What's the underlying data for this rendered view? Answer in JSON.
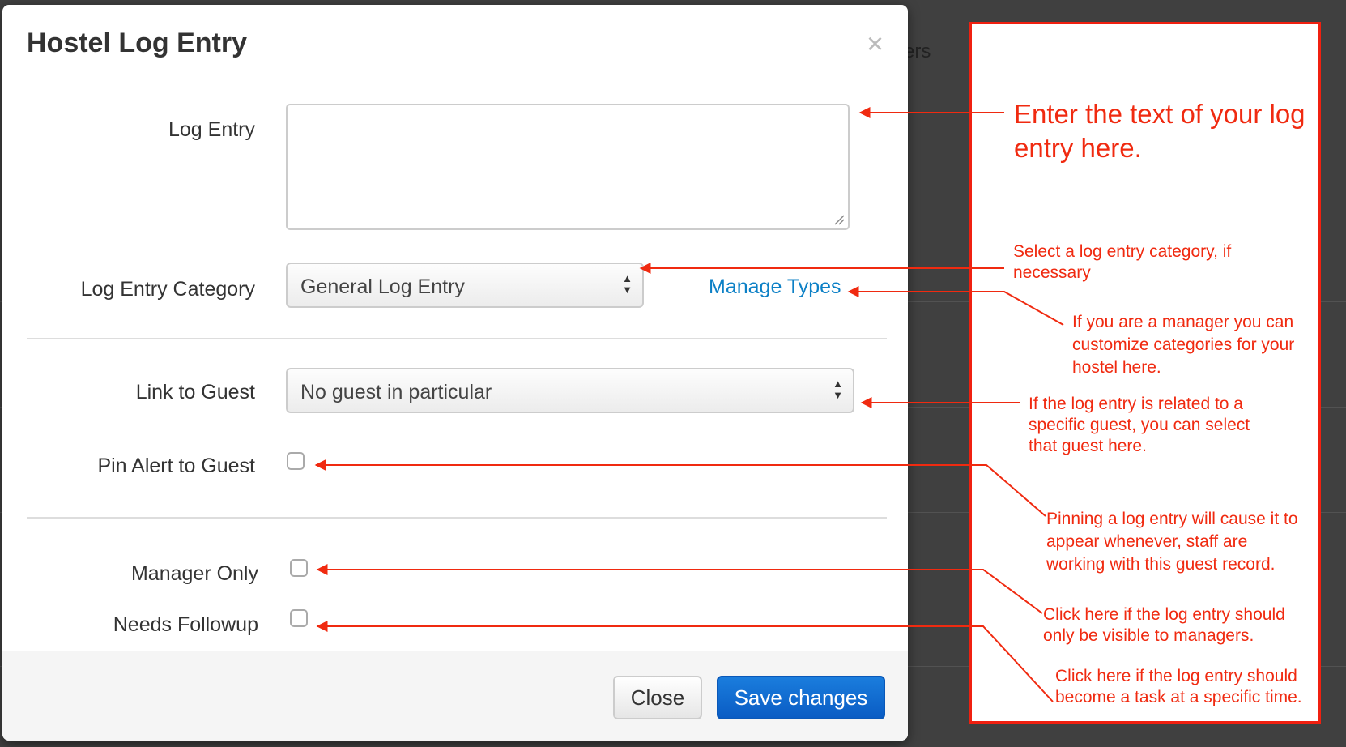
{
  "background": {
    "partial_text": "ers"
  },
  "modal": {
    "title": "Hostel Log Entry",
    "close_glyph": "×",
    "fields": {
      "log_entry_label": "Log Entry",
      "log_entry_value": "",
      "category_label": "Log Entry Category",
      "category_value": "General Log Entry",
      "manage_types_link": "Manage Types",
      "guest_label": "Link to Guest",
      "guest_value": "No guest in particular",
      "pin_label": "Pin Alert to Guest",
      "pin_checked": false,
      "manager_only_label": "Manager Only",
      "manager_only_checked": false,
      "needs_followup_label": "Needs Followup",
      "needs_followup_checked": false
    },
    "footer": {
      "close_label": "Close",
      "save_label": "Save changes"
    }
  },
  "annotations": {
    "log_entry": "Enter the text of your log entry here.",
    "category": "Select a log entry category, if necessary",
    "manage_types": "If you are a manager you can customize categories for your hostel here.",
    "guest": "If the log entry is related to a specific guest, you can select that guest here.",
    "pin": "Pinning a log entry will cause it to appear whenever, staff are working with this guest record.",
    "manager_only": "Click here if the log entry should only be visible to managers.",
    "needs_followup": "Click here if the log entry should become a task at a specific time."
  },
  "colors": {
    "annotation": "#f02a10",
    "link": "#0c80c6",
    "primary_button": "#0a5cc4"
  }
}
